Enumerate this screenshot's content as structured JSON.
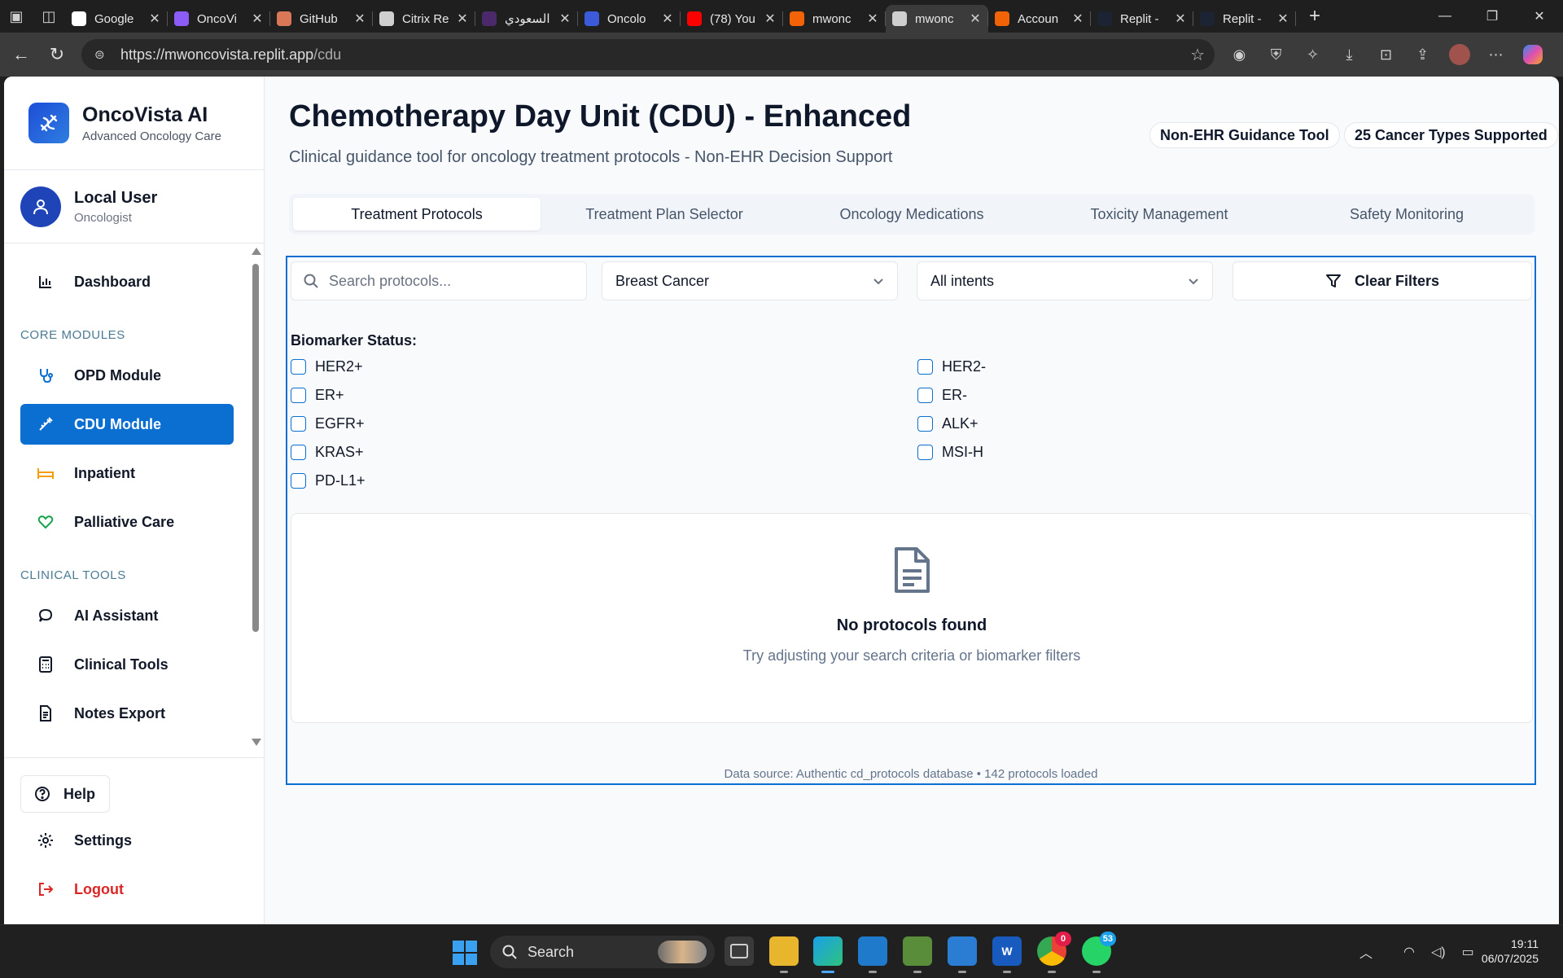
{
  "browser": {
    "tabs": [
      {
        "title": "Google",
        "icon": "google-icon",
        "color": "#ffffff"
      },
      {
        "title": "OncoVi",
        "icon": "vite-icon",
        "color": "#8b5cf6"
      },
      {
        "title": "GitHub",
        "icon": "claude-icon",
        "color": "#d97757"
      },
      {
        "title": "Citrix Re",
        "icon": "citrix-icon",
        "color": "#cfcfcf"
      },
      {
        "title": "السعودي",
        "icon": "saudi-icon",
        "color": "#4a2a6a"
      },
      {
        "title": "Oncolo",
        "icon": "onco-icon",
        "color": "#3b5bdb"
      },
      {
        "title": "(78) You",
        "icon": "youtube-icon",
        "color": "#ff0000"
      },
      {
        "title": "mwonc",
        "icon": "replit-icon",
        "color": "#f26207"
      },
      {
        "title": "mwonc",
        "icon": "globe-icon",
        "color": "#cfcfcf"
      },
      {
        "title": "Accoun",
        "icon": "replit-icon",
        "color": "#f26207"
      },
      {
        "title": "Replit -",
        "icon": "replit-dark-icon",
        "color": "#1c2333"
      },
      {
        "title": "Replit -",
        "icon": "replit-dark-icon",
        "color": "#1c2333"
      }
    ],
    "active_tab": 8,
    "url_host": "https://mwoncovista.replit.app",
    "url_path": "/cdu"
  },
  "sidebar": {
    "brand_name": "OncoVista AI",
    "brand_sub": "Advanced Oncology Care",
    "user_name": "Local User",
    "user_role": "Oncologist",
    "dashboard": "Dashboard",
    "core_heading": "CORE MODULES",
    "core": [
      {
        "label": "OPD Module",
        "icon": "stethoscope-icon"
      },
      {
        "label": "CDU Module",
        "icon": "syringe-icon"
      },
      {
        "label": "Inpatient",
        "icon": "bed-icon"
      },
      {
        "label": "Palliative Care",
        "icon": "heart-icon"
      }
    ],
    "tools_heading": "CLINICAL TOOLS",
    "tools": [
      {
        "label": "AI Assistant",
        "icon": "chat-icon"
      },
      {
        "label": "Clinical Tools",
        "icon": "calculator-icon"
      },
      {
        "label": "Notes Export",
        "icon": "document-icon"
      }
    ],
    "help": "Help",
    "settings": "Settings",
    "logout": "Logout",
    "colors": {
      "active": "#0b6fd1",
      "logout": "#dc2626",
      "bed": "#f59e0b",
      "heart": "#16a34a"
    }
  },
  "main": {
    "title": "Chemotherapy Day Unit (CDU) - Enhanced",
    "subtitle": "Clinical guidance tool for oncology treatment protocols - Non-EHR Decision Support",
    "badge_1": "Non-EHR Guidance Tool",
    "badge_2": "25 Cancer Types Supported",
    "tabs": [
      "Treatment Protocols",
      "Treatment Plan Selector",
      "Oncology Medications",
      "Toxicity Management",
      "Safety Monitoring"
    ],
    "selected_tab": 0,
    "search_placeholder": "Search protocols...",
    "cancer_select": "Breast Cancer",
    "intent_select": "All intents",
    "clear_filters": "Clear Filters",
    "biomarker_label": "Biomarker Status:",
    "biomarkers_left": [
      "HER2+",
      "ER+",
      "EGFR+",
      "KRAS+",
      "PD-L1+"
    ],
    "biomarkers_right": [
      "HER2-",
      "ER-",
      "ALK+",
      "MSI-H"
    ],
    "empty_title": "No protocols found",
    "empty_sub": "Try adjusting your search criteria or biomarker filters",
    "data_source": "Data source: Authentic cd_protocols database • 142 protocols loaded"
  },
  "taskbar": {
    "search": "Search",
    "time": "19:11",
    "date": "06/07/2025",
    "chrome_badge": "0",
    "whatsapp_badge": "53"
  }
}
